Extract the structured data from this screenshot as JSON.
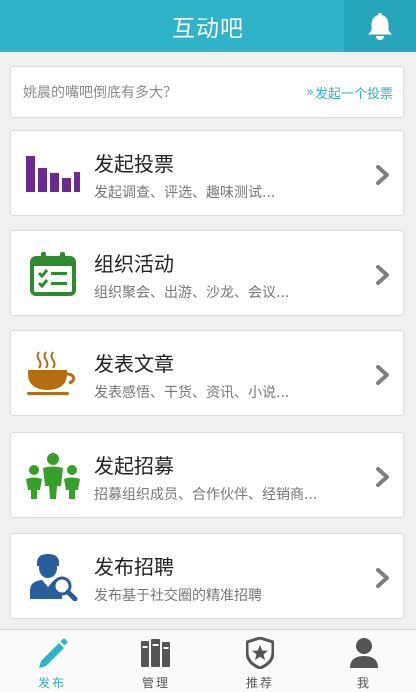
{
  "header": {
    "title": "互动吧",
    "bell_icon": "bell-icon"
  },
  "poll_bar": {
    "question": "姚晨的嘴吧倒底有多大？",
    "link_chevron": "»",
    "link_label": "发起一个投票"
  },
  "cards": [
    {
      "title": "发起投票",
      "subtitle": "发起调查、评选、趣味测试...",
      "icon": "bar-chart-icon",
      "icon_color": "#6b2a8f"
    },
    {
      "title": "组织活动",
      "subtitle": "组织聚会、出游、沙龙、会议...",
      "icon": "calendar-icon",
      "icon_color": "#2e8b2e"
    },
    {
      "title": "发表文章",
      "subtitle": "发表感悟、干货、资讯、小说...",
      "icon": "coffee-cup-icon",
      "icon_color": "#b56f12"
    },
    {
      "title": "发起招募",
      "subtitle": "招募组织成员、合作伙伴、经销商...",
      "icon": "people-group-icon",
      "icon_color": "#35a02a"
    },
    {
      "title": "发布招聘",
      "subtitle": "发布基于社交圈的精准招聘",
      "icon": "recruiter-search-icon",
      "icon_color": "#2a5d9c"
    }
  ],
  "tabs": [
    {
      "label": "发布",
      "icon": "pencil-icon",
      "active": true
    },
    {
      "label": "管理",
      "icon": "books-icon",
      "active": false
    },
    {
      "label": "推荐",
      "icon": "star-shield-icon",
      "active": false
    },
    {
      "label": "我",
      "icon": "person-icon",
      "active": false
    }
  ],
  "colors": {
    "accent": "#2fb3c9",
    "header_bg": "#2fb3c9",
    "bell_bg": "#27a6bb",
    "background": "#f0f0f0",
    "arrow": "#7f7f7f"
  }
}
